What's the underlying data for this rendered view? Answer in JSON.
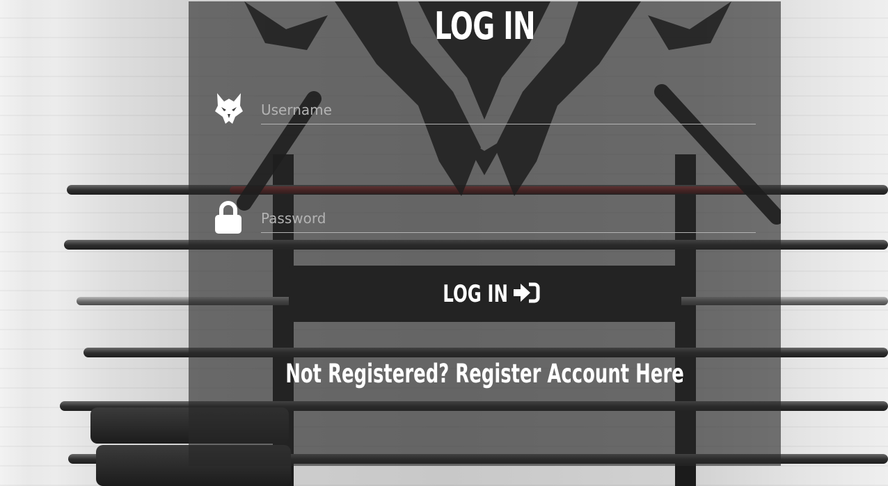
{
  "form": {
    "title": "LOG IN",
    "username": {
      "placeholder": "Username",
      "value": "",
      "icon": "wolf-head-icon"
    },
    "password": {
      "placeholder": "Password",
      "value": "",
      "icon": "lock-icon"
    },
    "submit_label": "LOG IN",
    "submit_icon": "sign-in-arrow-icon",
    "register_link_label": "Not Registered? Register Account Here"
  },
  "colors": {
    "panel_overlay": "#282828",
    "button_bg": "#232323",
    "text": "#ffffff",
    "placeholder": "#b3b3b3"
  }
}
